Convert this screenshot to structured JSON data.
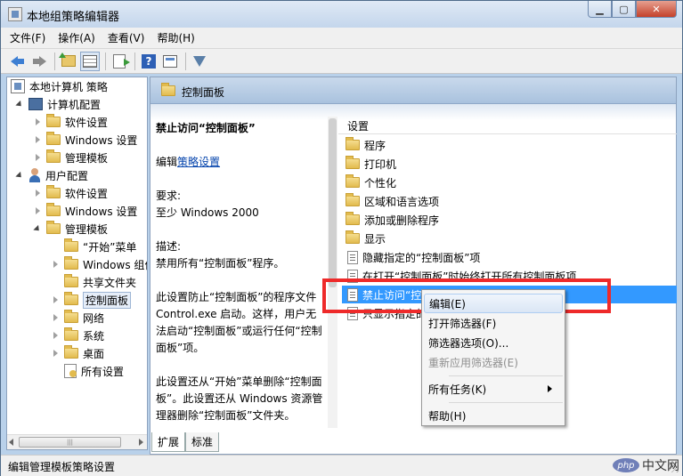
{
  "window": {
    "title": "本地组策略编辑器"
  },
  "menubar": [
    {
      "label": "文件(F)"
    },
    {
      "label": "操作(A)"
    },
    {
      "label": "查看(V)"
    },
    {
      "label": "帮助(H)"
    }
  ],
  "toolbar": {
    "buttons": [
      "back-icon",
      "forward-icon",
      "up-folder-icon",
      "show-tree-icon",
      "export-list-icon",
      "help-icon",
      "properties-icon",
      "filter-icon"
    ]
  },
  "tree": [
    {
      "label": "本地计算机 策略"
    },
    {
      "label": "计算机配置"
    },
    {
      "label": "软件设置"
    },
    {
      "label": "Windows 设置"
    },
    {
      "label": "管理模板"
    },
    {
      "label": "用户配置"
    },
    {
      "label": "软件设置"
    },
    {
      "label": "Windows 设置"
    },
    {
      "label": "管理模板"
    },
    {
      "label": "“开始”菜单"
    },
    {
      "label": "Windows 组件"
    },
    {
      "label": "共享文件夹"
    },
    {
      "label": "控制面板"
    },
    {
      "label": "网络"
    },
    {
      "label": "系统"
    },
    {
      "label": "桌面"
    },
    {
      "label": "所有设置"
    }
  ],
  "header": {
    "title": "控制面板"
  },
  "description": {
    "title": "禁止访问“控制面板”",
    "edit_prefix": "编辑",
    "edit_link": "策略设置",
    "req_label": "要求:",
    "req_value": "至少 Windows 2000",
    "desc_label": "描述:",
    "desc_line": "禁用所有“控制面板”程序。",
    "para1": "此设置防止“控制面板”的程序文件 Control.exe 启动。这样，用户无法启动“控制面板”或运行任何“控制面板”项。",
    "para2": "此设置还从“开始”菜单删除“控制面板”。此设置还从 Windows 资源管理器删除“控制面板”文件夹。"
  },
  "list": {
    "column": "设置",
    "rows": [
      {
        "label": "程序",
        "kind": "folder"
      },
      {
        "label": "打印机",
        "kind": "folder"
      },
      {
        "label": "个性化",
        "kind": "folder"
      },
      {
        "label": "区域和语言选项",
        "kind": "folder"
      },
      {
        "label": "添加或删除程序",
        "kind": "folder"
      },
      {
        "label": "显示",
        "kind": "folder"
      },
      {
        "label": "隐藏指定的“控制面板”项",
        "kind": "setting"
      },
      {
        "label": "在打开“控制面板”时始终打开所有控制面板项",
        "kind": "setting"
      },
      {
        "label": "禁止访问“控制面板”",
        "kind": "setting",
        "selected": true
      },
      {
        "label": "只显示指定的“控制面板”项",
        "kind": "setting"
      }
    ]
  },
  "tabs": [
    {
      "label": "扩展"
    },
    {
      "label": "标准"
    }
  ],
  "context_menu": [
    {
      "label": "编辑(E)"
    },
    {
      "label": "打开筛选器(F)"
    },
    {
      "label": "筛选器选项(O)..."
    },
    {
      "label": "重新应用筛选器(E)"
    },
    {
      "label": "所有任务(K)"
    },
    {
      "label": "帮助(H)"
    }
  ],
  "status": {
    "text": "编辑管理模板策略设置"
  },
  "watermark": {
    "brand": "php",
    "text": "中文网"
  },
  "colors": {
    "selection": "#3399ff",
    "annotation": "#ee2a2a",
    "header": "#b9d1ea"
  }
}
